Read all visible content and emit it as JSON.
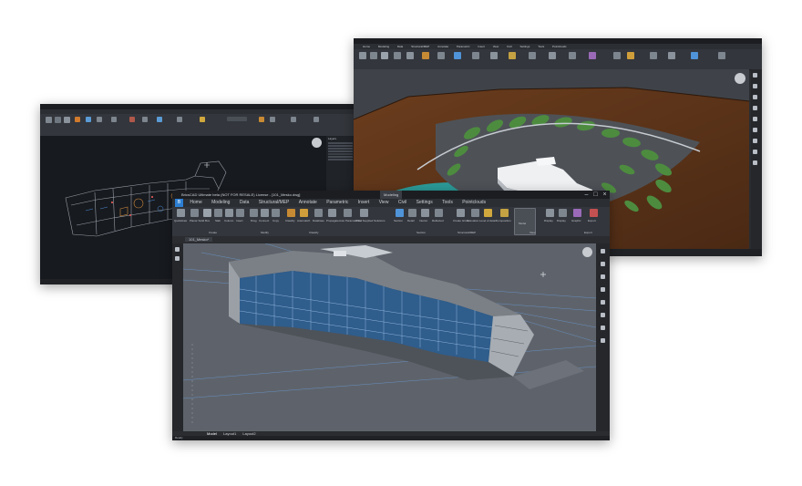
{
  "colors": {
    "dark_bg": "#131519",
    "cad_bg": "#171a1f",
    "render_bg": "#495057",
    "model_bg": "#5e636b",
    "terrain": "#5a3319",
    "water": "#2b9a98",
    "grass": "#4d8c3f",
    "accent": "#2d7fd3"
  },
  "win_left": {
    "title": "",
    "layer_label": "Layers"
  },
  "win_right": {
    "title": "",
    "menu": [
      "Home",
      "Modeling",
      "Data",
      "Structural/MEP",
      "Annotate",
      "Parametric",
      "Insert",
      "View",
      "Civil",
      "Settings",
      "Tools",
      "Pointclouds"
    ],
    "panel_labels": [
      "Create",
      "Modify",
      "Classify",
      "Section",
      "Structural/MEP",
      "View",
      "Export"
    ]
  },
  "win_front": {
    "title": "BricsCAD Ultimate beta (NOT FOR RESALE) License - [101_Mesko.dwg]",
    "workspace": "Modeling",
    "menu": [
      "Home",
      "Modeling",
      "Data",
      "Structural/MEP",
      "Annotate",
      "Parametric",
      "Insert",
      "View",
      "Civil",
      "Settings",
      "Tools",
      "Pointclouds"
    ],
    "ribbon_buttons": [
      "Quickdraw",
      "Planar Solid",
      "Box",
      "Slab",
      "Column",
      "Insert",
      "Drag",
      "Connect",
      "Copy",
      "Classify",
      "Automatch",
      "Database",
      "Propagate",
      "Auto Parameterize",
      "Wind Supplied Solutions",
      "Section",
      "Detail",
      "Interior",
      "Reflected",
      "Create Grids",
      "Elevation",
      "Level of detail",
      "Composition",
      "Model",
      "Display",
      "Display",
      "Graphic",
      "Export"
    ],
    "panel_labels": [
      "Create",
      "Modify",
      "Classify",
      "Section",
      "Structural/MEP",
      "View",
      "Export"
    ],
    "doc_tab": "101_Mesko*",
    "layout_tabs": [
      "Model",
      "Layout1",
      "Layout2"
    ],
    "status": "Ready"
  },
  "icons": [
    "lightbulb-icon",
    "compass-icon",
    "layers-icon",
    "properties-icon",
    "structure-icon",
    "render-icon",
    "bim-icon",
    "help-icon",
    "settings-icon",
    "search-icon",
    "navigation-cube-icon"
  ]
}
